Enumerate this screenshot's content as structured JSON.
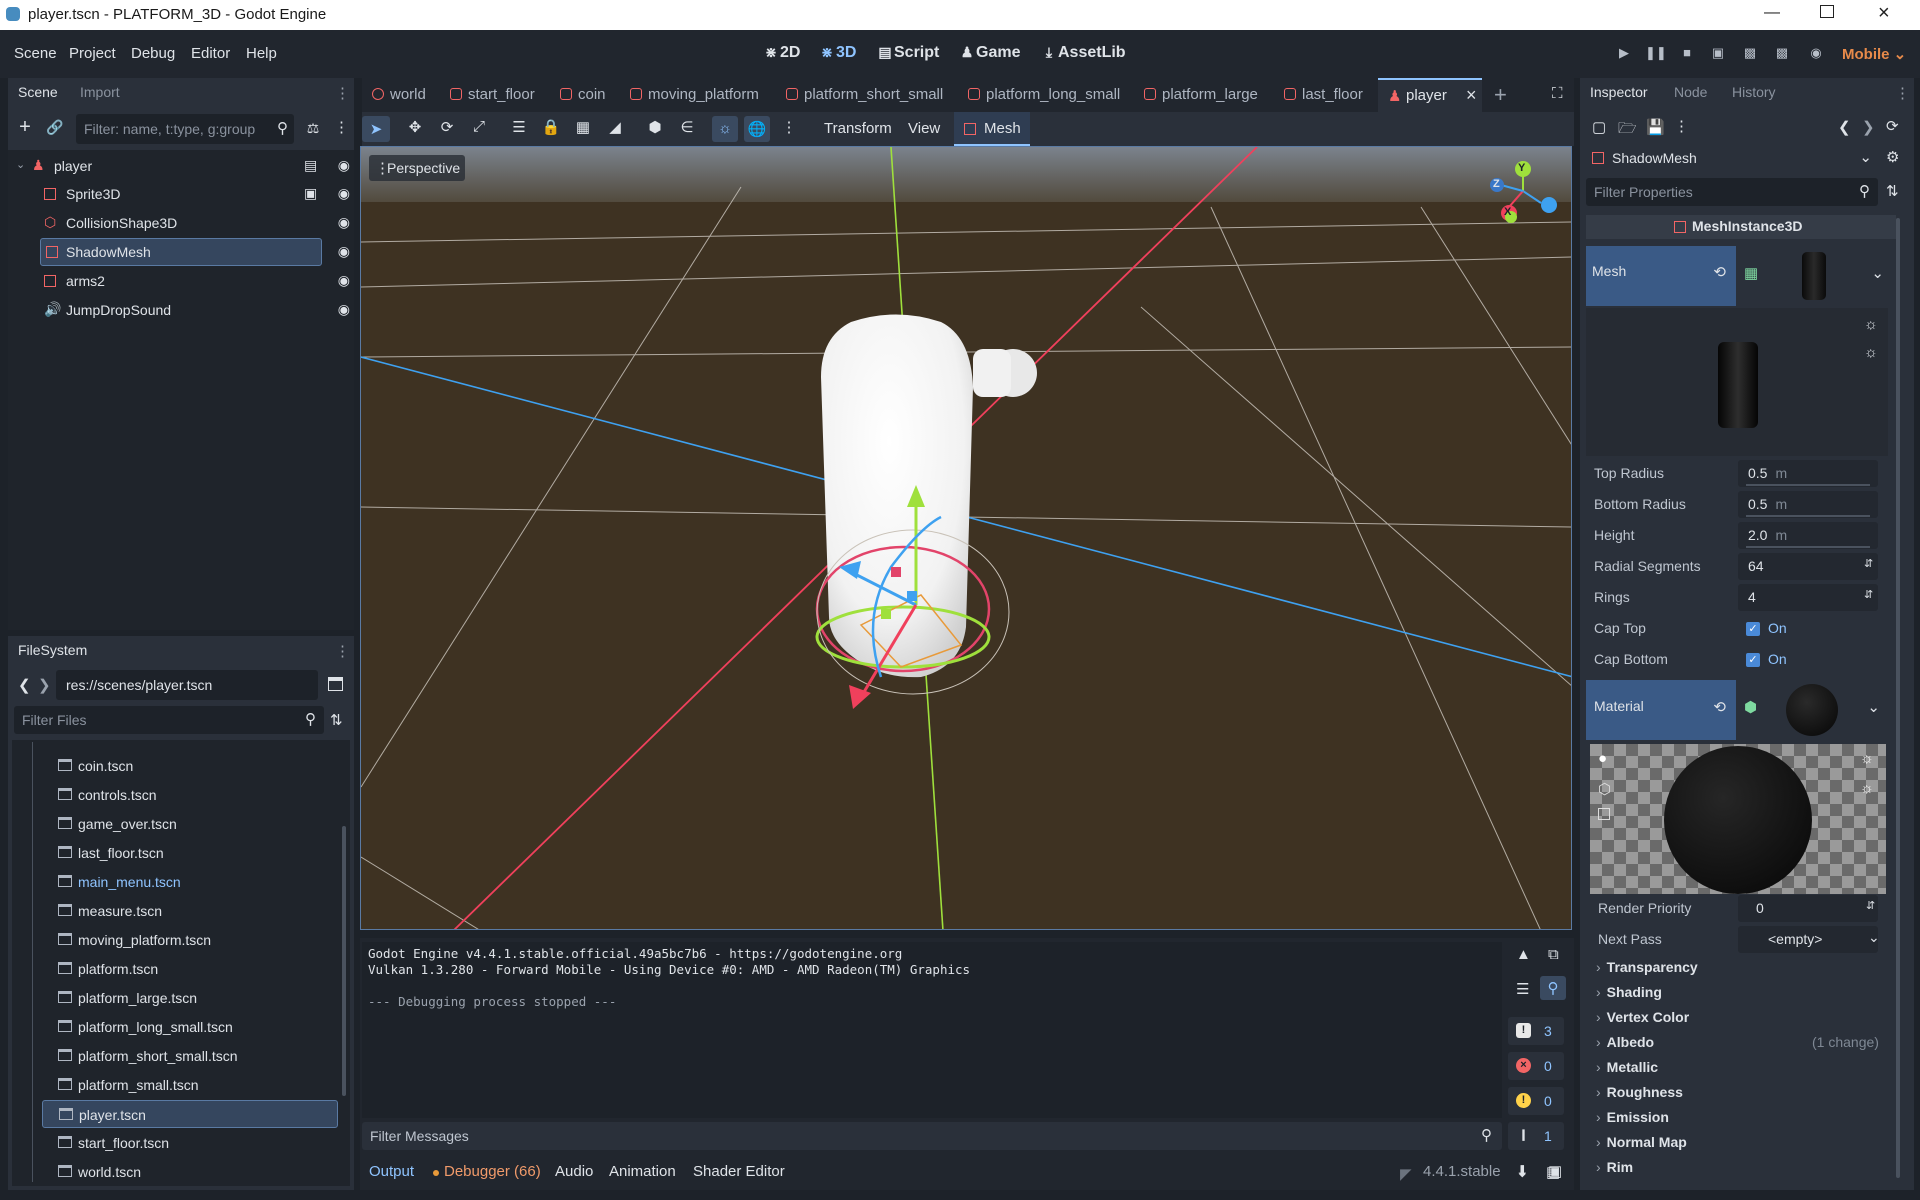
{
  "window": {
    "title": "player.tscn - PLATFORM_3D - Godot Engine"
  },
  "menu": {
    "items": [
      "Scene",
      "Project",
      "Debug",
      "Editor",
      "Help"
    ]
  },
  "modes": {
    "d2": "2D",
    "d3": "3D",
    "script": "Script",
    "game": "Game",
    "assetlib": "AssetLib"
  },
  "renderer": "Mobile",
  "scene_dock": {
    "tabs": [
      "Scene",
      "Import"
    ],
    "filter_placeholder": "Filter: name, t:type, g:group",
    "nodes": [
      {
        "label": "player",
        "icon": "character-body-icon"
      },
      {
        "label": "Sprite3D",
        "icon": "sprite3d-icon"
      },
      {
        "label": "CollisionShape3D",
        "icon": "collision-shape-icon"
      },
      {
        "label": "ShadowMesh",
        "icon": "mesh-instance-icon"
      },
      {
        "label": "arms2",
        "icon": "mesh-instance-icon"
      },
      {
        "label": "JumpDropSound",
        "icon": "audio-player-icon"
      }
    ]
  },
  "filesystem": {
    "tab": "FileSystem",
    "path": "res://scenes/player.tscn",
    "filter_placeholder": "Filter Files",
    "files": [
      "coin.tscn",
      "controls.tscn",
      "game_over.tscn",
      "last_floor.tscn",
      "main_menu.tscn",
      "measure.tscn",
      "moving_platform.tscn",
      "platform.tscn",
      "platform_large.tscn",
      "platform_long_small.tscn",
      "platform_short_small.tscn",
      "platform_small.tscn",
      "player.tscn",
      "start_floor.tscn",
      "world.tscn"
    ],
    "selected": "player.tscn"
  },
  "scene_tabs": [
    "world",
    "start_floor",
    "coin",
    "moving_platform",
    "platform_short_small",
    "platform_long_small",
    "platform_large",
    "last_floor",
    "player"
  ],
  "viewport_toolbar": {
    "transform": "Transform",
    "view": "View",
    "mesh": "Mesh"
  },
  "viewport": {
    "perspective": "Perspective",
    "gizmo_axes": [
      "Y",
      "Z",
      "X"
    ]
  },
  "output": {
    "lines": [
      "Godot Engine v4.4.1.stable.official.49a5bc7b6 - https://godotengine.org",
      "Vulkan 1.3.280 - Forward Mobile - Using Device #0: AMD - AMD Radeon(TM) Graphics",
      "",
      "--- Debugging process stopped ---"
    ],
    "filter_placeholder": "Filter Messages",
    "counts": {
      "messages": "3",
      "errors": "0",
      "warnings": "0",
      "other": "1"
    }
  },
  "bottom_tabs": [
    "Output",
    "Debugger (66)",
    "Audio",
    "Animation",
    "Shader Editor"
  ],
  "version": "4.4.1.stable",
  "inspector": {
    "tabs": [
      "Inspector",
      "Node",
      "History"
    ],
    "object": "ShadowMesh",
    "filter_placeholder": "Filter Properties",
    "class": "MeshInstance3D",
    "mesh_label": "Mesh",
    "properties": [
      {
        "label": "Top Radius",
        "value": "0.5",
        "unit": "m"
      },
      {
        "label": "Bottom Radius",
        "value": "0.5",
        "unit": "m"
      },
      {
        "label": "Height",
        "value": "2.0",
        "unit": "m"
      },
      {
        "label": "Radial Segments",
        "value": "64",
        "unit": ""
      },
      {
        "label": "Rings",
        "value": "4",
        "unit": ""
      }
    ],
    "cap_top": {
      "label": "Cap Top",
      "value": "On"
    },
    "cap_bottom": {
      "label": "Cap Bottom",
      "value": "On"
    },
    "material_label": "Material",
    "render_priority": {
      "label": "Render Priority",
      "value": "0"
    },
    "next_pass": {
      "label": "Next Pass",
      "value": "<empty>"
    },
    "sections": [
      "Transparency",
      "Shading",
      "Vertex Color",
      "Albedo",
      "Metallic",
      "Roughness",
      "Emission",
      "Normal Map",
      "Rim"
    ],
    "albedo_note": "(1 change)"
  }
}
